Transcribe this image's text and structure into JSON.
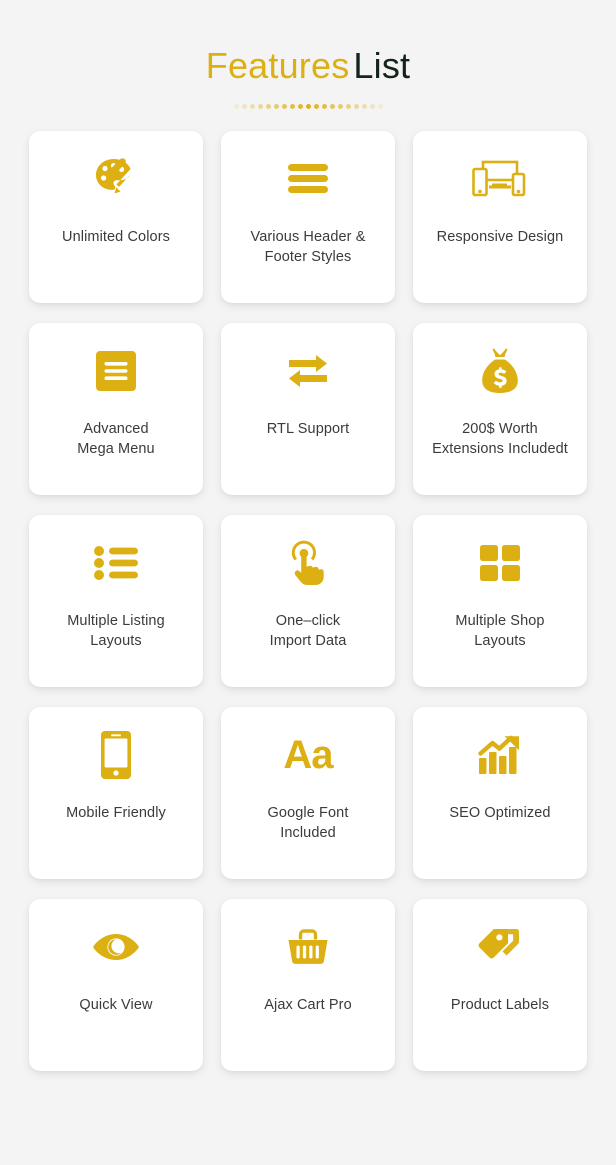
{
  "header": {
    "title_accent": "Features",
    "title_rest": "List",
    "accent_color": "#dcb012",
    "title_color": "#14241a",
    "dot_count": 19,
    "divider_name": "dotted-divider"
  },
  "theme": {
    "page_background": "#f4f4f4",
    "card_background": "#ffffff",
    "icon_color": "#dcb012",
    "label_color": "#3b3b3b"
  },
  "features": [
    {
      "icon": "palette-icon",
      "label": "Unlimited Colors"
    },
    {
      "icon": "hamburger-menu-icon",
      "label": "Various Header &\nFooter Styles"
    },
    {
      "icon": "responsive-devices-icon",
      "label": "Responsive Design"
    },
    {
      "icon": "mega-menu-icon",
      "label": "Advanced\nMega Menu"
    },
    {
      "icon": "exchange-arrows-icon",
      "label": "RTL Support"
    },
    {
      "icon": "money-bag-icon",
      "label": "200$ Worth\nExtensions Includedt"
    },
    {
      "icon": "bullet-list-icon",
      "label": "Multiple Listing\nLayouts"
    },
    {
      "icon": "hand-tap-icon",
      "label": "One–click\nImport Data"
    },
    {
      "icon": "grid-squares-icon",
      "label": "Multiple Shop\nLayouts"
    },
    {
      "icon": "mobile-phone-icon",
      "label": "Mobile Friendly"
    },
    {
      "icon": "typography-aa-icon",
      "label": "Google Font\nIncluded"
    },
    {
      "icon": "growth-chart-icon",
      "label": "SEO Optimized"
    },
    {
      "icon": "eye-icon",
      "label": "Quick View"
    },
    {
      "icon": "shopping-basket-icon",
      "label": "Ajax Cart Pro"
    },
    {
      "icon": "price-tags-icon",
      "label": "Product Labels"
    }
  ]
}
